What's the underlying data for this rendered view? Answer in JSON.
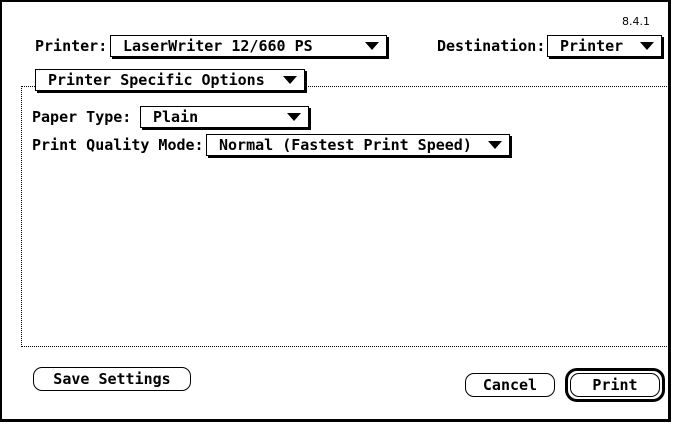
{
  "version": "8.4.1",
  "printer": {
    "label": "Printer:",
    "value": "LaserWriter 12/660 PS"
  },
  "destination": {
    "label": "Destination:",
    "value": "Printer"
  },
  "panel": {
    "value": "Printer Specific Options"
  },
  "paper_type": {
    "label": "Paper Type:",
    "value": "Plain"
  },
  "print_quality": {
    "label": "Print Quality Mode:",
    "value": "Normal (Fastest Print Speed)"
  },
  "buttons": {
    "save_settings": "Save Settings",
    "cancel": "Cancel",
    "print": "Print"
  }
}
